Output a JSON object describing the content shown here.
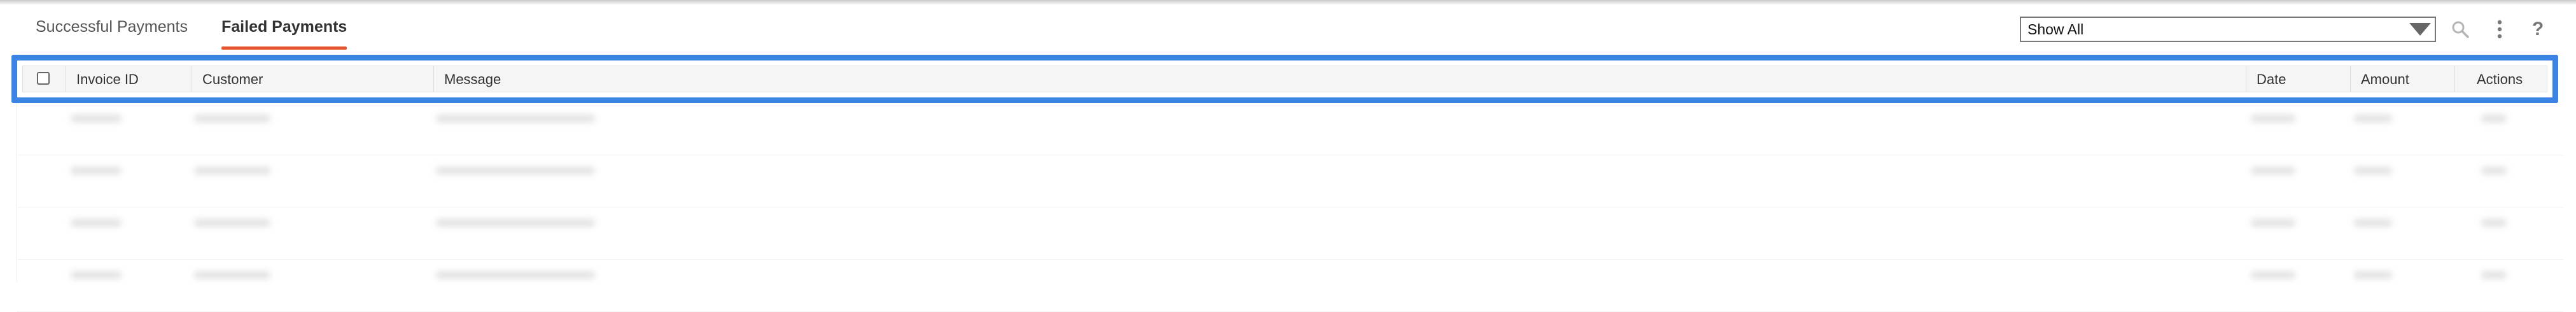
{
  "tabs": [
    {
      "label": "Successful Payments",
      "active": false
    },
    {
      "label": "Failed Payments",
      "active": true
    }
  ],
  "filter": {
    "selected": "Show All"
  },
  "toolbar": {
    "icons": [
      "search-icon",
      "more-vert-icon",
      "help-icon"
    ],
    "help_glyph": "?"
  },
  "table": {
    "columns": [
      "Invoice ID",
      "Customer",
      "Message",
      "Date",
      "Amount",
      "Actions"
    ],
    "row_count_visible": 4
  },
  "colors": {
    "accent_underline": "#e5542b",
    "highlight_border": "#3c84e4",
    "header_bg": "#f5f5f5"
  }
}
